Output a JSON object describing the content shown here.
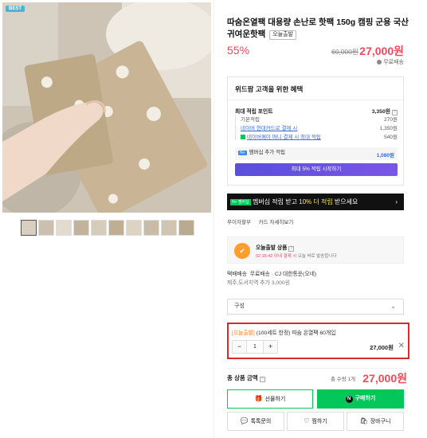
{
  "gallery": {
    "badge": "BEST",
    "thumbnail_count": 10
  },
  "product": {
    "title": "따숨온열팩 대용량 손난로 핫팩 150g 캠핑 군용 국산 귀여운핫팩",
    "tag": "오늘출발",
    "discount": "55%",
    "original_price": "60,000원",
    "sale_price": "27,000원",
    "shipping": "무료배송"
  },
  "benefits": {
    "title": "위드팜 고객을 위한 혜택",
    "max_points_label": "최대 적립 포인트",
    "max_points_value": "3,350원",
    "basic_label": "기본적립",
    "basic_value": "270원",
    "card_label": "네이버 현대카드로 결제 시",
    "card_value": "1,350원",
    "npay_label": "네이버페이 머니 결제 시 최대 적립",
    "npay_value": "540원",
    "plus_label": "멤버십 추가 적립",
    "plus_value": "1,080원",
    "plus_button": "최대 5% 적립 시작하기"
  },
  "banner": {
    "badge": "N+ 멤버십",
    "text_pre": "멤버십 적립 받고 ",
    "text_hl": "10% 더 적립",
    "text_post": " 받으세요",
    "chevron": "›"
  },
  "links": {
    "interest_free": "무이자할부",
    "card_benefits": "카드 자세히보기"
  },
  "today": {
    "icon_text": "✔",
    "title": "오늘출발 상품",
    "desc_red": "02:15:42 이내 결제 시",
    "desc_rest": " 오늘 바로 발송합니다"
  },
  "shipping_info": {
    "line1_label": "택배배송",
    "line1_value": "무료배송 · CJ 대한통운(오네)",
    "line2": "제주,도서지역 추가 3,000원"
  },
  "option_select": {
    "label": "구성",
    "chevron": "⌄"
  },
  "selected_option": {
    "tag": "[오늘출발]",
    "name": "(100세트 한정) 따숨 온열팩 60개입",
    "minus": "−",
    "quantity": "1",
    "plus": "+",
    "price": "27,000원",
    "remove": "✕"
  },
  "total": {
    "label": "총 상품 금액",
    "count": "총 수량 1개",
    "price": "27,000원"
  },
  "buttons": {
    "gift": "선물하기",
    "buy": "구매하기",
    "talk": "톡톡문의",
    "zzim": "찜하기",
    "cart": "장바구니"
  },
  "colors": {
    "accent_red": "#f04a5d",
    "naver_green": "#03c75a",
    "highlight_border": "#d42b2b"
  }
}
